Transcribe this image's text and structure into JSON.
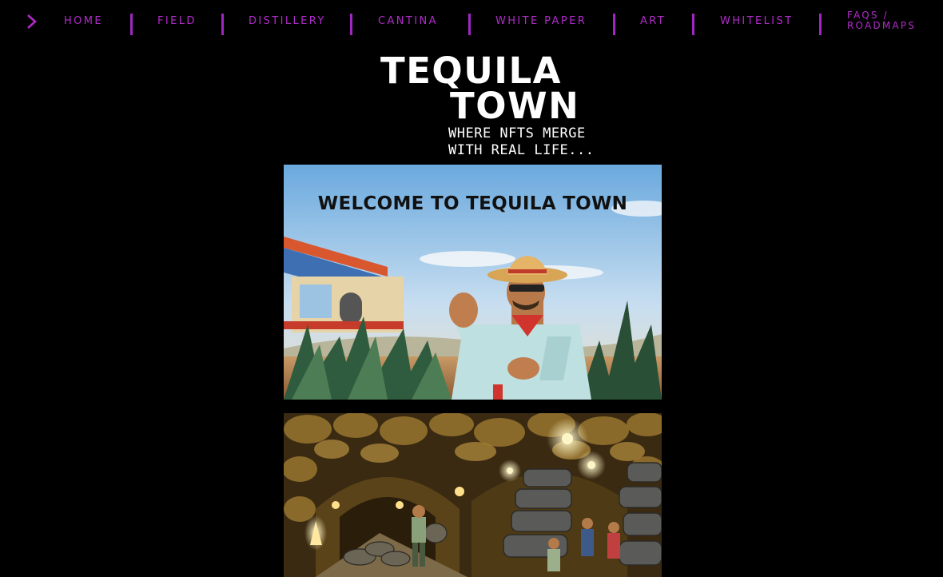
{
  "nav": {
    "items": [
      {
        "label": "HOME"
      },
      {
        "label": "FIELD"
      },
      {
        "label": "DISTILLERY"
      },
      {
        "label": "CANTINA"
      },
      {
        "label": "WHITE PAPER"
      },
      {
        "label": "ART"
      },
      {
        "label": "WHITELIST"
      },
      {
        "label_line1": "FAQS /",
        "label_line2": "ROADMAPS"
      }
    ],
    "accent_color": "#b02bc9",
    "arrow_icon": "chevron-right-icon"
  },
  "logo": {
    "line1": "TEQUILA",
    "line2": "TOWN",
    "tagline_line1": "WHERE NFTS MERGE",
    "tagline_line2": "WITH REAL LIFE..."
  },
  "panels": {
    "field": {
      "title": "WELCOME TO TEQUILA TOWN"
    }
  }
}
